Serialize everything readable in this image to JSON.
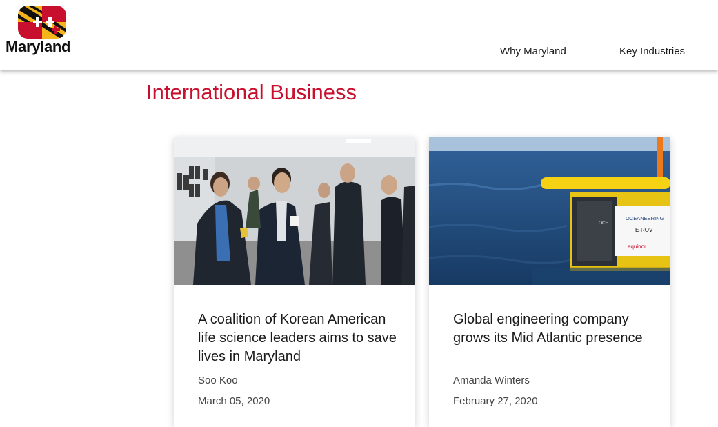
{
  "brand": {
    "name": "Maryland",
    "logo_icon": "maryland-flag-icon",
    "colors": {
      "black": "#111111",
      "gold": "#f4b41a",
      "red": "#c8102e",
      "white": "#ffffff"
    }
  },
  "nav": {
    "items": [
      {
        "label": "Why Maryland"
      },
      {
        "label": "Key Industries"
      }
    ]
  },
  "page": {
    "title": "International Business",
    "accent_color": "#c8102e"
  },
  "cards": [
    {
      "image_icon": "photo-networking-event-icon",
      "title": "A coalition of Korean American life science leaders aims to save lives in Maryland",
      "author": "Soo Koo",
      "date": "March 05, 2020"
    },
    {
      "image_icon": "photo-ocean-equipment-icon",
      "image_text": [
        "OCEANEERING",
        "E-ROV",
        "equinor",
        "OCE"
      ],
      "title": "Global engineering company grows its Mid Atlantic presence",
      "author": "Amanda Winters",
      "date": "February 27, 2020"
    }
  ]
}
